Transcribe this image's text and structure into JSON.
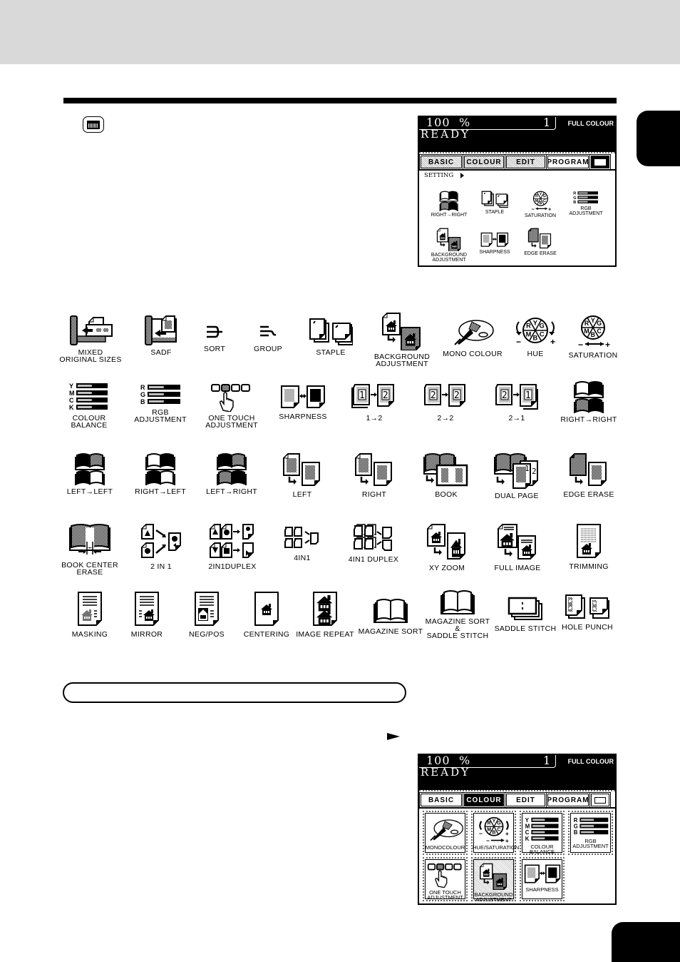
{
  "page": {
    "keyboard_icon": "lcd-keyboard-key-icon",
    "next_indicator": "continue-arrow"
  },
  "panel_top": {
    "zoom": "100",
    "percent": "%",
    "copies": "1",
    "mode": "FULL COLOUR",
    "status": "READY",
    "tabs": [
      "BASIC",
      "COLOUR",
      "EDIT",
      "PROGRAM"
    ],
    "setting_label": "SETTING",
    "items": [
      {
        "label": "RIGHT→RIGHT",
        "icon": "book-right-right-icon"
      },
      {
        "label": "STAPLE",
        "icon": "staple-icon"
      },
      {
        "label": "SATURATION",
        "icon": "saturation-icon"
      },
      {
        "label": "RGB\nADJUSTMENT",
        "icon": "rgb-adjustment-icon"
      },
      {
        "label": "BACKGROUND\nADJUSTMENT",
        "icon": "background-adjustment-icon"
      },
      {
        "label": "SHARPNESS",
        "icon": "sharpness-icon"
      },
      {
        "label": "EDGE ERASE",
        "icon": "edge-erase-icon"
      }
    ]
  },
  "icon_grid": [
    {
      "label": "MIXED\nORIGINAL SIZES",
      "icon": "mixed-original-sizes-icon"
    },
    {
      "label": "SADF",
      "icon": "sadf-icon"
    },
    {
      "label": "SORT",
      "icon": "sort-icon"
    },
    {
      "label": "GROUP",
      "icon": "group-icon"
    },
    {
      "label": "STAPLE",
      "icon": "staple-icon"
    },
    {
      "label": "BACKGROUND\nADJUSTMENT",
      "icon": "background-adjustment-icon"
    },
    {
      "label": "MONO COLOUR",
      "icon": "mono-colour-icon"
    },
    {
      "label": "HUE",
      "icon": "hue-icon"
    },
    {
      "label": "SATURATION",
      "icon": "saturation-icon"
    },
    {
      "label": "COLOUR BALANCE",
      "icon": "colour-balance-icon"
    },
    {
      "label": "RGB\nADJUSTMENT",
      "icon": "rgb-adjustment-icon"
    },
    {
      "label": "ONE TOUCH\nADJUSTMENT",
      "icon": "one-touch-adjustment-icon"
    },
    {
      "label": "SHARPNESS",
      "icon": "sharpness-icon"
    },
    {
      "label": "1→2",
      "icon": "duplex-1-to-2-icon"
    },
    {
      "label": "2→2",
      "icon": "duplex-2-to-2-icon"
    },
    {
      "label": "2→1",
      "icon": "duplex-2-to-1-icon"
    },
    {
      "label": "RIGHT→RIGHT",
      "icon": "book-right-right-icon"
    },
    {
      "label": "LEFT→LEFT",
      "icon": "book-left-left-icon"
    },
    {
      "label": "RIGHT→LEFT",
      "icon": "book-right-left-icon"
    },
    {
      "label": "LEFT→RIGHT",
      "icon": "book-left-right-icon"
    },
    {
      "label": "LEFT",
      "icon": "image-shift-left-icon"
    },
    {
      "label": "RIGHT",
      "icon": "image-shift-right-icon"
    },
    {
      "label": "BOOK",
      "icon": "book-icon"
    },
    {
      "label": "DUAL PAGE",
      "icon": "dual-page-icon"
    },
    {
      "label": "EDGE ERASE",
      "icon": "edge-erase-icon"
    },
    {
      "label": "BOOK CENTER\nERASE",
      "icon": "book-center-erase-icon"
    },
    {
      "label": "2 IN 1",
      "icon": "two-in-one-icon"
    },
    {
      "label": "2IN1DUPLEX",
      "icon": "two-in-one-duplex-icon"
    },
    {
      "label": "4IN1",
      "icon": "four-in-one-icon"
    },
    {
      "label": "4IN1 DUPLEX",
      "icon": "four-in-one-duplex-icon"
    },
    {
      "label": "XY ZOOM",
      "icon": "xy-zoom-icon"
    },
    {
      "label": "FULL IMAGE",
      "icon": "full-image-icon"
    },
    {
      "label": "TRIMMING",
      "icon": "trimming-icon"
    },
    {
      "label": "MASKING",
      "icon": "masking-icon"
    },
    {
      "label": "MIRROR",
      "icon": "mirror-icon"
    },
    {
      "label": "NEG/POS",
      "icon": "neg-pos-icon"
    },
    {
      "label": "CENTERING",
      "icon": "centering-icon"
    },
    {
      "label": "IMAGE REPEAT",
      "icon": "image-repeat-icon"
    },
    {
      "label": "MAGAZINE SORT",
      "icon": "magazine-sort-icon"
    },
    {
      "label": "MAGAZINE SORT\n&\nSADDLE STITCH",
      "icon": "magazine-sort-saddle-stitch-icon"
    },
    {
      "label": "SADDLE STITCH",
      "icon": "saddle-stitch-icon"
    },
    {
      "label": "HOLE PUNCH",
      "icon": "hole-punch-icon"
    }
  ],
  "panel_bottom": {
    "zoom": "100",
    "percent": "%",
    "copies": "1",
    "mode": "FULL COLOUR",
    "status": "READY",
    "tabs": [
      "BASIC",
      "COLOUR",
      "EDIT",
      "PROGRAM"
    ],
    "active_tab": "COLOUR",
    "buttons": [
      {
        "label": "MONOCOLOUR",
        "icon": "mono-colour-icon"
      },
      {
        "label": "HUE/SATURATION",
        "icon": "hue-saturation-icon"
      },
      {
        "label": "COLOUR BALANCE",
        "icon": "colour-balance-icon"
      },
      {
        "label": "RGB\nADJUSTMENT",
        "icon": "rgb-adjustment-icon"
      },
      {
        "label": "ONE TOUCH\nADJUSTMENT",
        "icon": "one-touch-adjustment-icon"
      },
      {
        "label": "BACKGROUND\nADJUSTMENT",
        "icon": "background-adjustment-icon"
      },
      {
        "label": "SHARPNESS",
        "icon": "sharpness-icon"
      }
    ]
  },
  "rgb_letters": [
    "R",
    "G",
    "B"
  ],
  "ymck_letters": [
    "Y",
    "M",
    "C",
    "K"
  ],
  "wheel_letters": [
    "R",
    "Y",
    "G",
    "M",
    "B",
    "C"
  ],
  "duplex_numbers": {
    "a": [
      "1",
      "2"
    ],
    "b": [
      "2",
      "2"
    ],
    "c": [
      "2",
      "1"
    ]
  },
  "dual_page_numbers": [
    "1",
    "2"
  ]
}
